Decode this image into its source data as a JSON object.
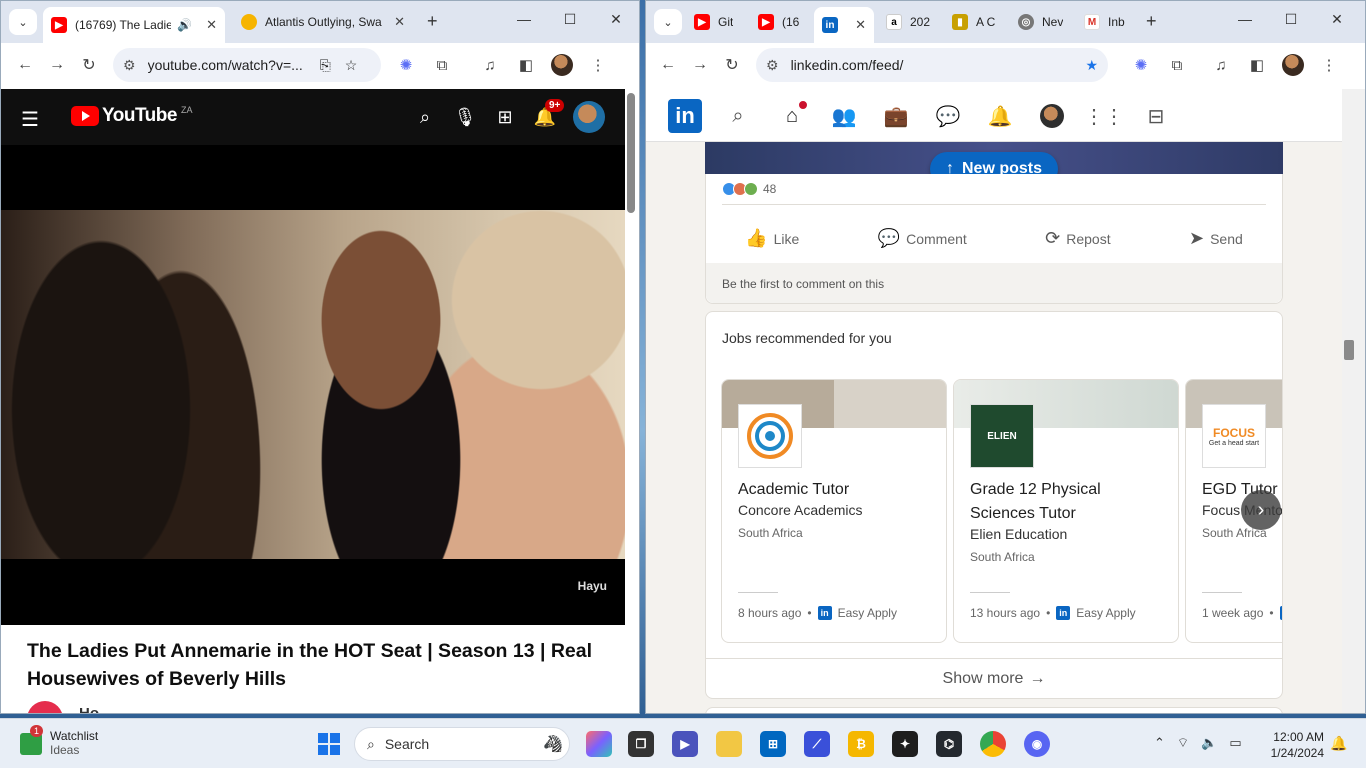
{
  "youtube_window": {
    "tabs": [
      {
        "title": "(16769) The Ladies",
        "active": true
      },
      {
        "title": "Atlantis Outlying, Swa",
        "active": false
      }
    ],
    "url": "youtube.com/watch?v=...",
    "header": {
      "logo_text": "YouTube",
      "country_code": "ZA",
      "notifications_badge": "9+"
    },
    "video": {
      "watermark": "Hayu",
      "title": "The Ladies Put Annemarie in the HOT Seat | Season 13 | Real Housewives of Beverly Hills",
      "channel_initial": "Ho"
    }
  },
  "linkedin_window": {
    "tabs": [
      {
        "title": "Git",
        "active": false
      },
      {
        "title": "(16",
        "active": false
      },
      {
        "title": "",
        "active": true
      },
      {
        "title": "202",
        "active": false
      },
      {
        "title": "A C",
        "active": false
      },
      {
        "title": "Nev",
        "active": false
      },
      {
        "title": "Inb",
        "active": false
      }
    ],
    "url": "linkedin.com/feed/",
    "new_posts_label": "New posts",
    "post": {
      "reaction_count": "48",
      "actions": [
        "Like",
        "Comment",
        "Repost",
        "Send"
      ],
      "first_comment_prompt": "Be the first to comment on this"
    },
    "jobs": {
      "heading": "Jobs recommended for you",
      "items": [
        {
          "title": "Academic Tutor",
          "company": "Concore Academics",
          "location": "South Africa",
          "posted": "8 hours ago",
          "apply": "Easy Apply"
        },
        {
          "title": "Grade 12 Physical Sciences Tutor",
          "company": "Elien Education",
          "location": "South Africa",
          "posted": "13 hours ago",
          "apply": "Easy Apply",
          "logo_text": "ELIEN"
        },
        {
          "title": "EGD Tutor",
          "company": "Focus Mento",
          "location": "South Africa",
          "posted": "1 week ago",
          "logo_text": "FOCUS",
          "logo_tagline": "Get a head start"
        }
      ],
      "show_more": "Show more"
    }
  },
  "taskbar": {
    "widget": {
      "title": "Watchlist",
      "subtitle": "Ideas",
      "badge": "1"
    },
    "search_placeholder": "Search",
    "time": "12:00 AM",
    "date": "1/24/2024"
  },
  "colors": {
    "youtube_red": "#ff0000",
    "linkedin_blue": "#0a66c2",
    "notification_red": "#cc0000"
  }
}
